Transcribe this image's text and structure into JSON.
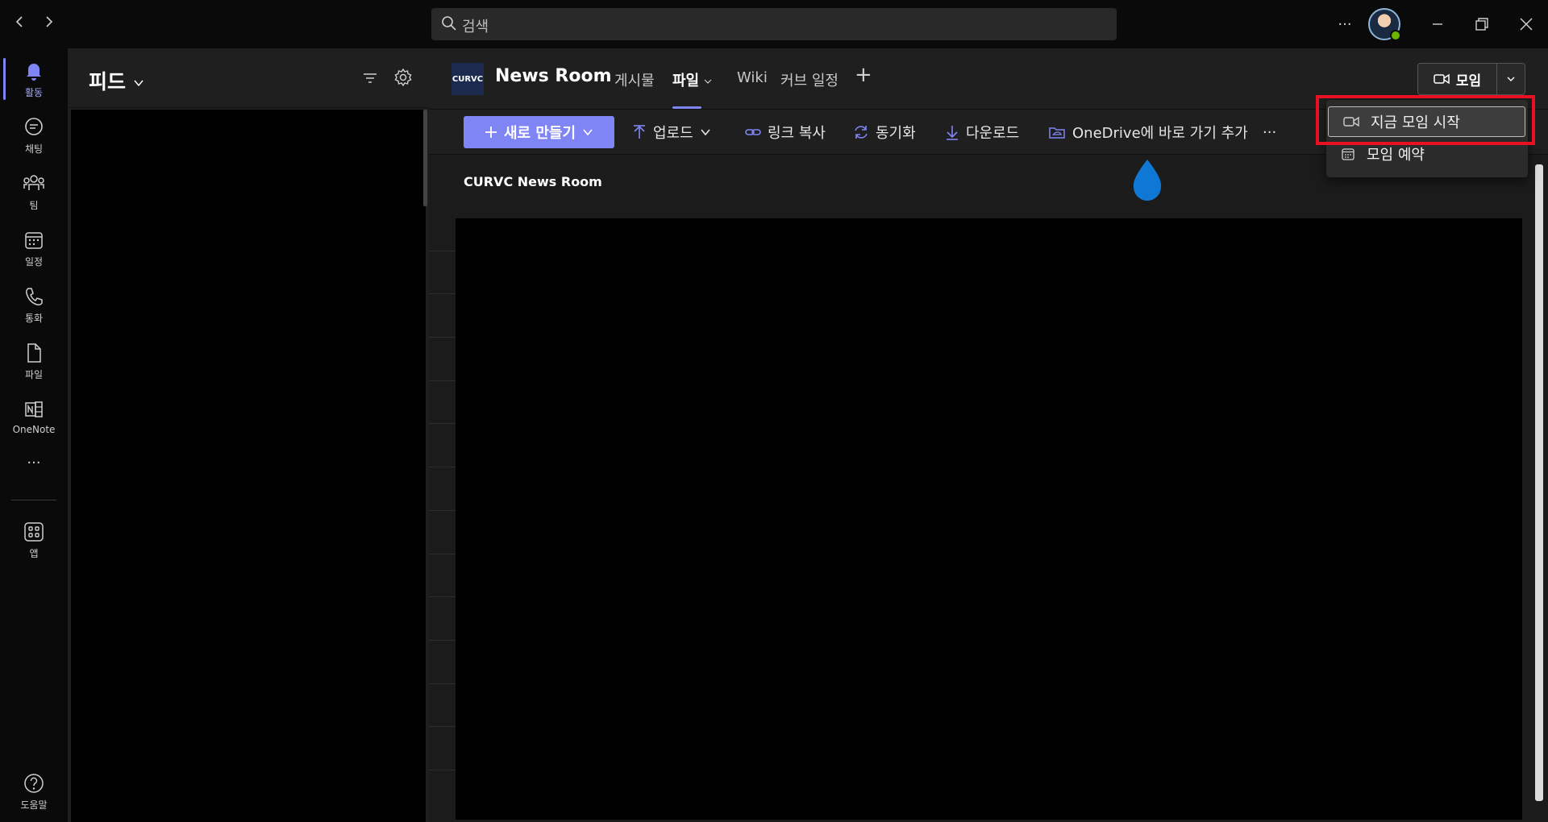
{
  "window": {
    "search_placeholder": "검색",
    "more_label": "···"
  },
  "rail": {
    "items": [
      {
        "label": "활동",
        "icon": "bell-icon",
        "active": true
      },
      {
        "label": "채팅",
        "icon": "chat-icon"
      },
      {
        "label": "팀",
        "icon": "teams-icon"
      },
      {
        "label": "일정",
        "icon": "calendar-icon"
      },
      {
        "label": "통화",
        "icon": "phone-icon"
      },
      {
        "label": "파일",
        "icon": "file-icon"
      },
      {
        "label": "OneNote",
        "icon": "onenote-icon"
      }
    ],
    "more": "···",
    "apps_label": "앱",
    "help_label": "도움말"
  },
  "feed": {
    "title": "피드"
  },
  "channel": {
    "logo_text": "CURVC",
    "team_name": "News Room",
    "tabs": [
      {
        "label": "게시물"
      },
      {
        "label": "파일",
        "active": true
      },
      {
        "label": "Wiki"
      },
      {
        "label": "커브 일정"
      }
    ],
    "add_tab": "+",
    "meet_label": "모임"
  },
  "toolbar": {
    "new_label": "새로 만들기",
    "upload_label": "업로드",
    "copy_link_label": "링크 복사",
    "sync_label": "동기화",
    "download_label": "다운로드",
    "onedrive_label": "OneDrive에 바로 가기 추가",
    "more_label": "···"
  },
  "files": {
    "breadcrumb": "CURVC News Room"
  },
  "meet_menu": {
    "items": [
      {
        "label": "지금 모임 시작",
        "icon": "video-camera-icon",
        "highlighted": true
      },
      {
        "label": "모임 예약",
        "icon": "calendar-icon"
      }
    ]
  },
  "colors": {
    "accent": "#7f85f5",
    "highlight_box": "#e81123",
    "presence": "#6bb700"
  }
}
